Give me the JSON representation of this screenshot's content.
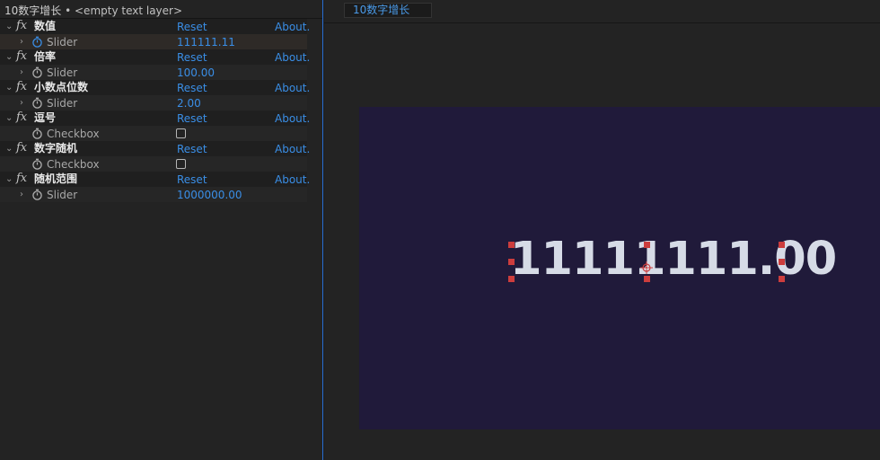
{
  "panel": {
    "title": "10数字增长",
    "separator": " • ",
    "layer": "<empty text layer>"
  },
  "effects": [
    {
      "name": "数值",
      "reset": "Reset",
      "about": "About.",
      "property": {
        "label": "Slider",
        "type": "slider",
        "value": "111111.11"
      }
    },
    {
      "name": "倍率",
      "reset": "Reset",
      "about": "About.",
      "property": {
        "label": "Slider",
        "type": "slider",
        "value": "100.00"
      }
    },
    {
      "name": "小数点位数",
      "reset": "Reset",
      "about": "About.",
      "property": {
        "label": "Slider",
        "type": "slider",
        "value": "2.00"
      }
    },
    {
      "name": "逗号",
      "reset": "Reset",
      "about": "About.",
      "property": {
        "label": "Checkbox",
        "type": "checkbox",
        "checked": false
      }
    },
    {
      "name": "数字随机",
      "reset": "Reset",
      "about": "About.",
      "property": {
        "label": "Checkbox",
        "type": "checkbox",
        "checked": false
      }
    },
    {
      "name": "随机范围",
      "reset": "Reset",
      "about": "About.",
      "property": {
        "label": "Slider",
        "type": "slider",
        "value": "1000000.00"
      }
    }
  ],
  "fx_badge": "fx",
  "viewer": {
    "tab_label": "10数字增长",
    "display_text": "11111111.00"
  },
  "colors": {
    "accent_blue": "#3a8ee6",
    "panel_border": "#2a6fd6",
    "canvas_bg": "#201a3a",
    "handle_red": "#cc3d3d",
    "text_light": "#d6dbe6"
  },
  "icons": {
    "twirl_open": "chevron-down-icon",
    "twirl_closed": "chevron-right-icon",
    "stopwatch": "stopwatch-icon",
    "anchor": "anchor-point-icon"
  }
}
